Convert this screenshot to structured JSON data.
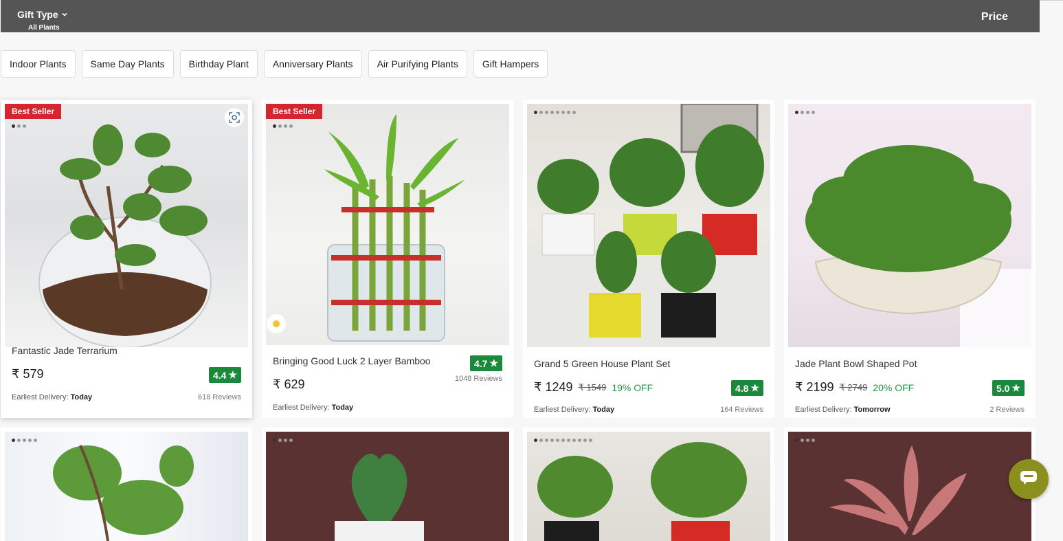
{
  "filters": {
    "gift_type_label": "Gift Type",
    "gift_type_value": "All Plants",
    "price_label": "Price"
  },
  "categories": [
    "Indoor Plants",
    "Same Day Plants",
    "Birthday Plant",
    "Anniversary Plants",
    "Air Purifying Plants",
    "Gift Hampers"
  ],
  "products": [
    {
      "badge": "Best Seller",
      "name": "Fantastic Jade Terrarium",
      "currency": "₹",
      "price": "579",
      "rating": "4.4",
      "reviews": "618  Reviews",
      "delivery_label": "Earliest Delivery:",
      "delivery": "Today"
    },
    {
      "badge": "Best Seller",
      "name": "Bringing Good Luck 2 Layer Bamboo",
      "currency": "₹",
      "price": "629",
      "rating": "4.7",
      "reviews": "1048  Reviews",
      "delivery_label": "Earliest Delivery:",
      "delivery": "Today"
    },
    {
      "name": "Grand 5 Green House Plant Set",
      "currency": "₹",
      "price": "1249",
      "old_price": "₹ 1549",
      "discount": "19% OFF",
      "rating": "4.8",
      "reviews": "164  Reviews",
      "delivery_label": "Earliest Delivery:",
      "delivery": "Today"
    },
    {
      "name": "Jade Plant Bowl Shaped Pot",
      "currency": "₹",
      "price": "2199",
      "old_price": "₹ 2749",
      "discount": "20% OFF",
      "rating": "5.0",
      "reviews": "2  Reviews",
      "delivery_label": "Earliest Delivery:",
      "delivery": "Tomorrow"
    }
  ],
  "colors": {
    "topbar": "#555555",
    "badge": "#d4262c",
    "rating": "#1a8a3a",
    "discount": "#1b9a3e",
    "chat": "#8a8f1e"
  },
  "icons": [
    "chevron-down-icon",
    "scan-icon",
    "star-icon",
    "chat-icon"
  ]
}
